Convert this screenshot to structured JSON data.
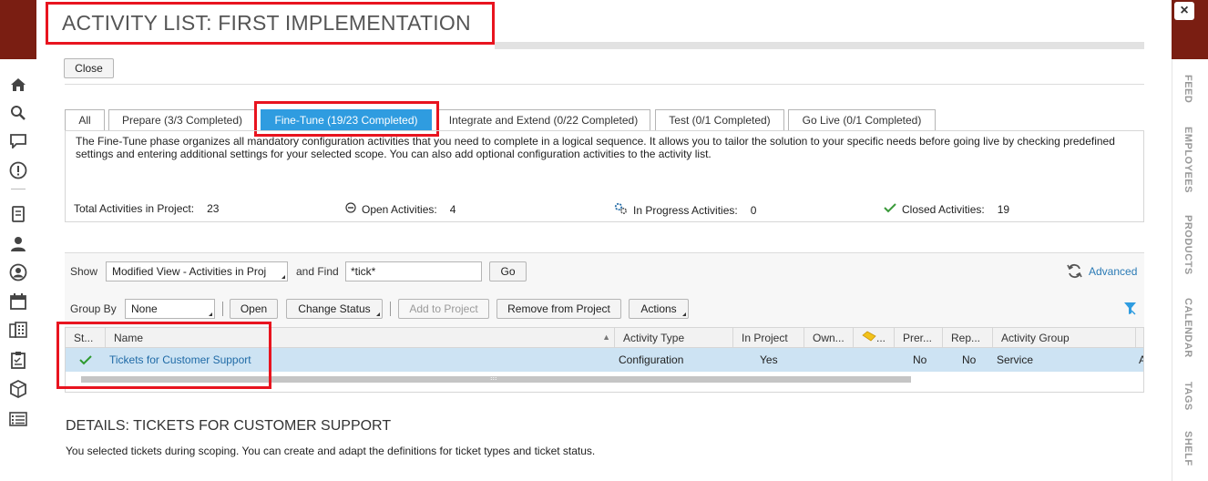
{
  "window": {
    "title": "ACTIVITY LIST: FIRST IMPLEMENTATION",
    "close_label": "Close",
    "close_x": "×"
  },
  "right_rail": {
    "tabs": [
      "FEED",
      "EMPLOYEES",
      "PRODUCTS",
      "CALENDAR",
      "TAGS",
      "SHELF"
    ]
  },
  "left_rail": {
    "icons": [
      "home-icon",
      "search-icon",
      "chat-icon",
      "alert-icon",
      "notebook-icon",
      "people-icon",
      "person-icon",
      "calendar-icon",
      "building-icon",
      "clipboard-icon",
      "box-icon",
      "list-icon"
    ]
  },
  "tabs": [
    {
      "label": "All",
      "active": false
    },
    {
      "label": "Prepare (3/3 Completed)",
      "active": false
    },
    {
      "label": "Fine-Tune (19/23 Completed)",
      "active": true
    },
    {
      "label": "Integrate and Extend (0/22 Completed)",
      "active": false
    },
    {
      "label": "Test (0/1 Completed)",
      "active": false
    },
    {
      "label": "Go Live (0/1 Completed)",
      "active": false
    }
  ],
  "description": "The Fine-Tune phase organizes all mandatory configuration activities that you need to complete in a logical sequence. It allows you to tailor the solution to your specific needs before going live by checking predefined settings and entering additional settings for your selected scope. You can also add optional configuration activities to the activity list.",
  "stats": {
    "total_label": "Total Activities in Project:",
    "total_value": "23",
    "open_label": "Open Activities:",
    "open_value": "4",
    "in_progress_label": "In Progress Activities:",
    "in_progress_value": "0",
    "closed_label": "Closed Activities:",
    "closed_value": "19"
  },
  "filter": {
    "show_label": "Show",
    "show_value": "Modified View - Activities in Proj",
    "find_label": "and Find",
    "find_value": "*tick*",
    "go_label": "Go",
    "advanced_label": "Advanced"
  },
  "toolbar": {
    "group_by_label": "Group By",
    "group_by_value": "None",
    "open_label": "Open",
    "change_status_label": "Change Status",
    "add_to_project_label": "Add to Project",
    "remove_label": "Remove from Project",
    "actions_label": "Actions"
  },
  "table": {
    "headers": [
      "St...",
      "Name",
      "Activity Type",
      "In Project",
      "Own...",
      "...",
      "Prer...",
      "Rep...",
      "Activity Group"
    ],
    "rows": [
      {
        "status": "✔",
        "name": "Tickets for Customer Support",
        "activity_type": "Configuration",
        "in_project": "Yes",
        "owner": "",
        "flag": "",
        "prerequisite": "No",
        "repeatable": "No",
        "activity_group": "Service",
        "overflow": "A"
      }
    ],
    "scroll_handle": "⁞⁞⁞"
  },
  "details": {
    "title": "DETAILS: TICKETS FOR CUSTOMER SUPPORT",
    "text": "You selected tickets during scoping. You can create and adapt the definitions for ticket types and ticket status."
  },
  "colors": {
    "accent": "#2f9ce0",
    "highlight_red": "#e8141f",
    "link": "#1f6aa6",
    "selected_row": "#cde3f3",
    "brand_dark": "#7a1e12"
  }
}
